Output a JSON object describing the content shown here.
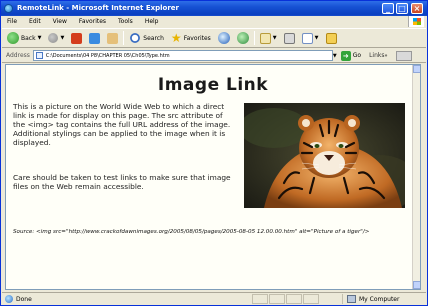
{
  "window": {
    "title": "RemoteLink - Microsoft Internet Explorer"
  },
  "menu": [
    "File",
    "Edit",
    "View",
    "Favorites",
    "Tools",
    "Help"
  ],
  "toolbar": {
    "back_label": "Back",
    "search_label": "Search",
    "favorites_label": "Favorites"
  },
  "addressbar": {
    "label": "Address",
    "url": "C:\\Documents\\04 P8\\CHAPTER 05\\Ch05\\Type.htm",
    "go_label": "Go",
    "links_label": "Links"
  },
  "page": {
    "title": "Image Link",
    "intro": "This is a picture on the World Wide Web to which a direct link is made for display on this page. The src attribute of the <img> tag contains the full URL address of the image. Additional stylings can be applied to the image when it is displayed.",
    "warning": "Care should be taken to test links to make sure that image files on the Web remain accessible.",
    "source_code": "Source: <img src=\"http://www.crackofdawnimages.org/2005/08/05/pages/2005-08-05 12.00.00.htm\" alt=\"Picture of a tiger\"/>"
  },
  "statusbar": {
    "status": "Done",
    "zone": "My Computer"
  },
  "icons": {
    "back": "back-arrow-icon",
    "forward": "forward-arrow-icon",
    "stop": "stop-icon",
    "refresh": "refresh-icon",
    "home": "home-icon",
    "search": "search-icon",
    "favorites": "favorites-star-icon",
    "media": "media-icon",
    "history": "history-icon",
    "mail": "mail-icon",
    "print": "print-icon",
    "edit": "edit-icon",
    "folder": "folder-icon"
  },
  "colors": {
    "titlebar": "#0a3fc0",
    "chrome": "#ece9d8",
    "page_background": "#fffff8"
  }
}
